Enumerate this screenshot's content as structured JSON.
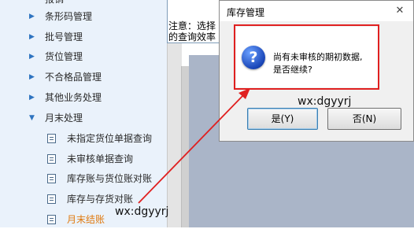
{
  "sidebar": {
    "partial_top": "报销",
    "items": [
      {
        "label": "条形码管理"
      },
      {
        "label": "批号管理"
      },
      {
        "label": "货位管理"
      },
      {
        "label": "不合格品管理"
      },
      {
        "label": "其他业务处理"
      },
      {
        "label": "月末处理",
        "expanded": true
      }
    ],
    "sub_items": [
      {
        "label": "未指定货位单据查询"
      },
      {
        "label": "未审核单据查询"
      },
      {
        "label": "库存账与货位账对账"
      },
      {
        "label": "库存与存货对账"
      },
      {
        "label": "月末结账",
        "active": true
      }
    ]
  },
  "background_window": {
    "notice_line1": "注意：选择",
    "notice_line2": "的查询效率"
  },
  "dialog": {
    "title": "库存管理",
    "close_icon": "close-icon",
    "message_line1": "尚有未审核的期初数据,",
    "message_line2": "是否继续?",
    "yes_label": "是(Y)",
    "no_label": "否(N)"
  },
  "watermarks": [
    "wx:dgyyrj",
    "wx:dgyyrj"
  ],
  "colors": {
    "highlight_box": "#e02020",
    "arrow": "#e02020",
    "active_item": "#e07a10",
    "sidebar_bg": "#eaf2fb"
  }
}
